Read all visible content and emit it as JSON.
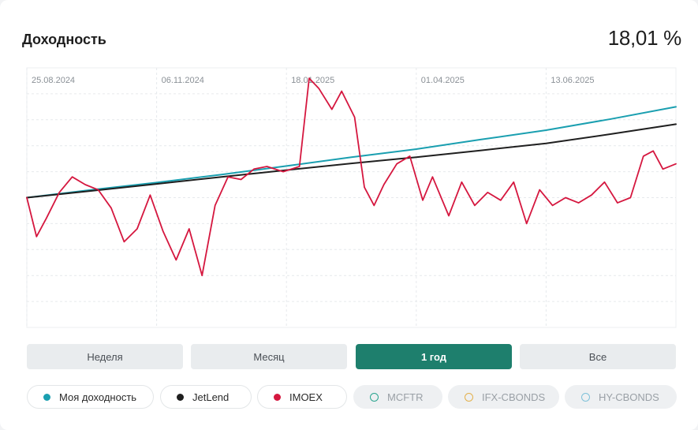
{
  "card": {
    "title": "Доходность",
    "value": "18,01 %"
  },
  "chart_data": {
    "type": "line",
    "x_ticks": [
      "25.08.2024",
      "06.11.2024",
      "18.01.2025",
      "01.04.2025",
      "13.06.2025"
    ],
    "grid": true,
    "ylim": [
      0,
      100
    ],
    "series": [
      {
        "name": "Моя доходность",
        "color": "#1a9fb0",
        "x": [
          0,
          0.1,
          0.2,
          0.3,
          0.4,
          0.5,
          0.6,
          0.7,
          0.8,
          0.9,
          1.0
        ],
        "y": [
          50.0,
          53.0,
          55.8,
          58.9,
          62.2,
          65.6,
          68.7,
          72.4,
          76.0,
          80.3,
          85.0
        ]
      },
      {
        "name": "JetLend",
        "color": "#1f1f1f",
        "x": [
          0,
          0.1,
          0.2,
          0.3,
          0.4,
          0.5,
          0.6,
          0.7,
          0.8,
          0.9,
          1.0
        ],
        "y": [
          50.0,
          52.6,
          55.3,
          58.0,
          60.6,
          63.2,
          65.6,
          68.2,
          70.9,
          74.5,
          78.3
        ]
      },
      {
        "name": "IMOEX",
        "color": "#d5173f",
        "x": [
          0,
          0.015,
          0.03,
          0.05,
          0.07,
          0.09,
          0.11,
          0.13,
          0.15,
          0.17,
          0.19,
          0.21,
          0.23,
          0.25,
          0.27,
          0.29,
          0.31,
          0.33,
          0.35,
          0.37,
          0.395,
          0.42,
          0.435,
          0.45,
          0.47,
          0.485,
          0.505,
          0.52,
          0.535,
          0.55,
          0.57,
          0.59,
          0.61,
          0.625,
          0.65,
          0.67,
          0.69,
          0.71,
          0.73,
          0.75,
          0.77,
          0.79,
          0.81,
          0.83,
          0.85,
          0.87,
          0.89,
          0.91,
          0.93,
          0.95,
          0.965,
          0.98,
          1.0
        ],
        "y": [
          50.0,
          35.0,
          42.0,
          52.0,
          58.0,
          55.0,
          53.0,
          46.0,
          33.0,
          38.0,
          51.0,
          37.0,
          26.0,
          38.0,
          20.0,
          47.0,
          58.0,
          57.0,
          61.0,
          62.0,
          60.0,
          62.0,
          96.0,
          92.0,
          84.0,
          91.0,
          81.0,
          54.0,
          47.0,
          55.0,
          63.0,
          66.0,
          49.0,
          58.0,
          43.0,
          56.0,
          47.0,
          52.0,
          49.0,
          56.0,
          40.0,
          53.0,
          47.0,
          50.0,
          48.0,
          51.0,
          56.0,
          48.0,
          50.0,
          66.0,
          68.0,
          61.0,
          63.0
        ]
      }
    ]
  },
  "periods": [
    {
      "label": "Неделя",
      "active": false
    },
    {
      "label": "Месяц",
      "active": false
    },
    {
      "label": "1 год",
      "active": true
    },
    {
      "label": "Все",
      "active": false
    }
  ],
  "legend": [
    {
      "label": "Моя доходность",
      "color": "#1a9fb0",
      "enabled": true
    },
    {
      "label": "JetLend",
      "color": "#1f1f1f",
      "enabled": true
    },
    {
      "label": "IMOEX",
      "color": "#d5173f",
      "enabled": true
    },
    {
      "label": "MCFTR",
      "color": "#2aa58f",
      "enabled": false
    },
    {
      "label": "IFX-CBONDS",
      "color": "#e3b04b",
      "enabled": false
    },
    {
      "label": "HY-CBONDS",
      "color": "#7fc1d9",
      "enabled": false
    }
  ]
}
